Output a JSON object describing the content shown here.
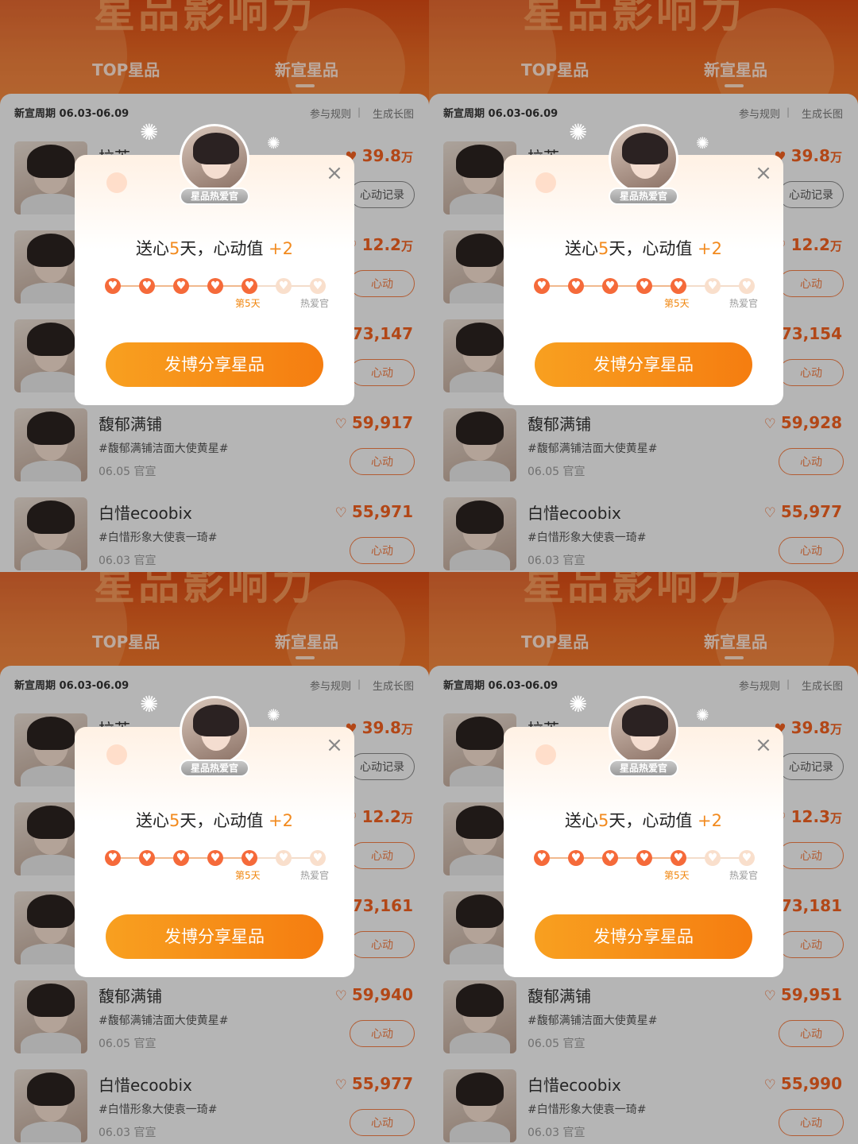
{
  "app": {
    "header_title": "星品影响力",
    "tabs": [
      "TOP星品",
      "新宣星品"
    ],
    "cycle_label": "新宣周期",
    "cycle_dates": "06.03-06.09",
    "rules_label": "参与规则",
    "generate_label": "生成长图"
  },
  "modal": {
    "badge": "星品热爱官",
    "title_prefix": "送心",
    "days": "5",
    "title_mid": "天，心动值",
    "plus": "+2",
    "day_label": "第5天",
    "final_label": "热爱官",
    "share_button": "发博分享星品",
    "close": "×"
  },
  "row_labels": {
    "record_button": "心动记录",
    "heart_button": "心动",
    "unit_wan": "万"
  },
  "panels": [
    {
      "rows": [
        {
          "name": "拉芙",
          "value": "39.8",
          "unit": "万",
          "button": "心动记录",
          "filled": true
        },
        {
          "name": "",
          "value": "12.2",
          "unit": "万",
          "button": "心动"
        },
        {
          "name": "",
          "value": "73,147",
          "unit": "",
          "button": "心动"
        },
        {
          "name": "馥郁满铺",
          "tag": "#馥郁满铺洁面大使黄星#",
          "date": "06.05 官宣",
          "value": "59,917",
          "unit": "",
          "button": "心动"
        },
        {
          "name": "白惜ecoobix",
          "tag": "#白惜形象大使袁一琦#",
          "date": "06.03 官宣",
          "value": "55,971",
          "unit": "",
          "button": "心动"
        }
      ]
    },
    {
      "rows": [
        {
          "name": "拉芙",
          "value": "39.8",
          "unit": "万",
          "button": "心动记录",
          "filled": true
        },
        {
          "name": "",
          "value": "12.2",
          "unit": "万",
          "button": "心动"
        },
        {
          "name": "",
          "value": "73,154",
          "unit": "",
          "button": "心动"
        },
        {
          "name": "馥郁满铺",
          "tag": "#馥郁满铺洁面大使黄星#",
          "date": "06.05 官宣",
          "value": "59,928",
          "unit": "",
          "button": "心动"
        },
        {
          "name": "白惜ecoobix",
          "tag": "#白惜形象大使袁一琦#",
          "date": "06.03 官宣",
          "value": "55,977",
          "unit": "",
          "button": "心动"
        }
      ]
    },
    {
      "rows": [
        {
          "name": "拉芙",
          "value": "39.8",
          "unit": "万",
          "button": "心动记录",
          "filled": true
        },
        {
          "name": "",
          "value": "12.2",
          "unit": "万",
          "button": "心动"
        },
        {
          "name": "",
          "value": "73,161",
          "unit": "",
          "button": "心动"
        },
        {
          "name": "馥郁满铺",
          "tag": "#馥郁满铺洁面大使黄星#",
          "date": "06.05 官宣",
          "value": "59,940",
          "unit": "",
          "button": "心动"
        },
        {
          "name": "白惜ecoobix",
          "tag": "#白惜形象大使袁一琦#",
          "date": "06.03 官宣",
          "value": "55,977",
          "unit": "",
          "button": "心动"
        }
      ]
    },
    {
      "rows": [
        {
          "name": "拉芙",
          "value": "39.8",
          "unit": "万",
          "button": "心动记录",
          "filled": true
        },
        {
          "name": "",
          "value": "12.3",
          "unit": "万",
          "button": "心动"
        },
        {
          "name": "",
          "value": "73,181",
          "unit": "",
          "button": "心动"
        },
        {
          "name": "馥郁满铺",
          "tag": "#馥郁满铺洁面大使黄星#",
          "date": "06.05 官宣",
          "value": "59,951",
          "unit": "",
          "button": "心动"
        },
        {
          "name": "白惜ecoobix",
          "tag": "#白惜形象大使袁一琦#",
          "date": "06.03 官宣",
          "value": "55,990",
          "unit": "",
          "button": "心动"
        }
      ]
    }
  ],
  "colors": {
    "accent": "#f57d10",
    "header": "#e05a1a",
    "heart": "#f06020"
  },
  "icons": {
    "heart": "heart-icon",
    "close": "close-icon",
    "sparkle": "sparkle-icon"
  },
  "progress": {
    "filled_days": 5,
    "total_steps": 7
  }
}
